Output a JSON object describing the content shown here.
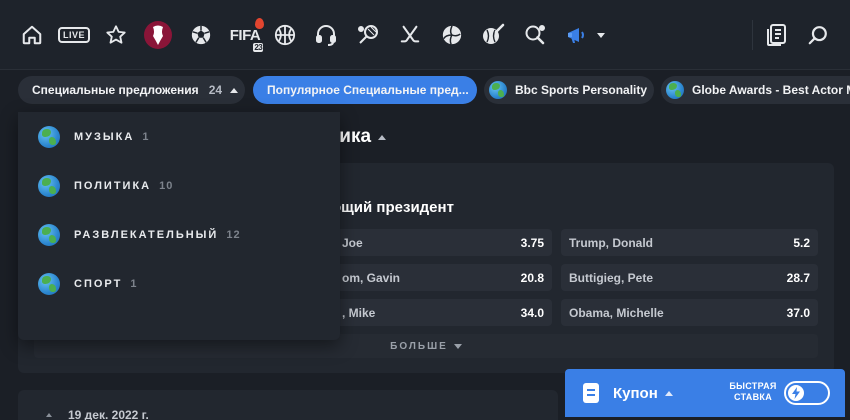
{
  "colors": {
    "background": "#1b1f26",
    "nav": "#1e232b",
    "accent": "#3a7fe6",
    "chip": "#2a2f38",
    "card": "#22272f"
  },
  "nav": {
    "icons": [
      "home-icon",
      "live-icon",
      "star-icon",
      "world-cup-icon",
      "soccer-ball-icon",
      "fifa-icon",
      "basketball-icon",
      "esports-headset-icon",
      "tennis-icon",
      "hockey-icon",
      "volleyball-icon",
      "baseball-icon",
      "table-tennis-icon",
      "promo-megaphone-icon",
      "bet-slip-icon",
      "search-icon"
    ],
    "live_label": "LIVE",
    "fifa_label": "FIFA",
    "fifa_number": "23"
  },
  "filters": {
    "specials_label": "Специальные предложения",
    "specials_count": "24",
    "chips": [
      {
        "label": "Популярное Специальные пред..."
      },
      {
        "label": "Bbc Sports Personality"
      },
      {
        "label": "Globe Awards - Best Actor M"
      }
    ]
  },
  "dropdown": {
    "items": [
      {
        "label": "МУЗЫКА",
        "count": "1"
      },
      {
        "label": "ПОЛИТИКА",
        "count": "10"
      },
      {
        "label": "РАЗВЛЕКАТЕЛЬНЫЙ",
        "count": "12"
      },
      {
        "label": "СПОРТ",
        "count": "1"
      }
    ]
  },
  "main": {
    "section_title": "тика",
    "market_title": "ующий президент",
    "odds": [
      {
        "name": "Joe",
        "price": "3.75"
      },
      {
        "name": "Trump, Donald",
        "price": "5.2"
      },
      {
        "name": "om, Gavin",
        "price": "20.8"
      },
      {
        "name": "Buttigieg, Pete",
        "price": "28.7"
      },
      {
        "name": ", Mike",
        "price": "34.0"
      },
      {
        "name": "Obama, Michelle",
        "price": "37.0"
      }
    ],
    "more_label": "БОЛЬШЕ",
    "date_label": "19 дек. 2022 г."
  },
  "coupon": {
    "label": "Купон",
    "quick_bet_label": "БЫСТРАЯ СТАВКА"
  }
}
